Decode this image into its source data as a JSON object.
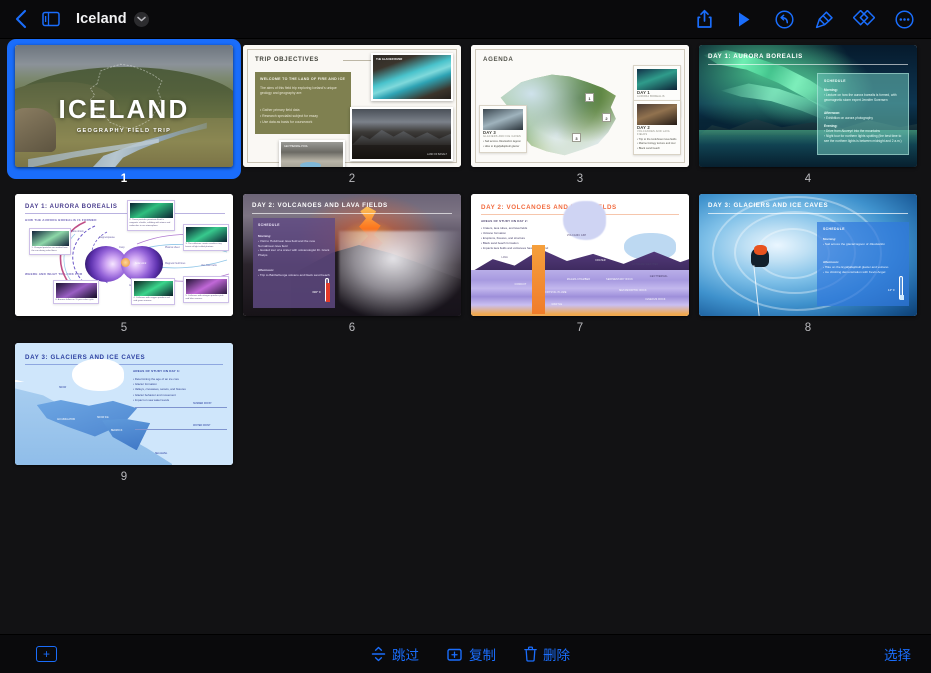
{
  "app": {
    "document_title": "Iceland",
    "accent_color": "#1a6dfb",
    "background_color": "#121214",
    "chrome_color": "#0a0a0c"
  },
  "topbar": {
    "back_icon": "chevron-left-icon",
    "sidebar_icon": "sidebar-toggle-icon",
    "title": "Iceland",
    "title_menu_icon": "chevron-down-icon",
    "actions": [
      {
        "name": "share-button",
        "icon": "share-icon"
      },
      {
        "name": "play-button",
        "icon": "play-icon"
      },
      {
        "name": "undo-button",
        "icon": "undo-icon"
      },
      {
        "name": "format-button",
        "icon": "paintbrush-icon"
      },
      {
        "name": "animate-button",
        "icon": "animate-diamonds-icon"
      },
      {
        "name": "more-button",
        "icon": "ellipsis-circle-icon"
      }
    ]
  },
  "bottombar": {
    "add_slide_label": "+",
    "add_slide_icon": "add-slide-icon",
    "skip_label": "跳过",
    "skip_icon": "skip-slide-icon",
    "duplicate_label": "复制",
    "duplicate_icon": "duplicate-icon",
    "delete_label": "删除",
    "delete_icon": "trash-icon",
    "select_label": "选择"
  },
  "grid": {
    "selected_slide": 1,
    "columns": 4,
    "slides": [
      {
        "number": "1",
        "title": "ICELAND",
        "subtitle": "GEOGRAPHY FIELD TRIP",
        "theme": "photo-hero-landscape",
        "selected": true
      },
      {
        "number": "2",
        "title": "TRIP OBJECTIVES",
        "theme": "cream-photo-collage",
        "box_heading": "WELCOME TO THE LAND OF FIRE AND ICE",
        "box_paragraph": "The aims of this field trip exploring Iceland's unique geology and geography are:",
        "bullets": [
          "Gather primary field data",
          "Research specialist subject for essay",
          "Use data as basis for coursework"
        ],
        "photo_captions": [
          "THE GLACIER RIVER",
          "LAND OF BASALT",
          "GEOTHERMAL POOL"
        ]
      },
      {
        "number": "3",
        "title": "AGENDA",
        "theme": "map-agenda",
        "map_markers": [
          "1",
          "2",
          "3"
        ],
        "cards": [
          {
            "day": "DAY 1",
            "subject": "AURORA BOREALIS",
            "points": [
              "Lecture on aurora borealis",
              "Aurora close-ups",
              "Viewing of northern lights"
            ]
          },
          {
            "day": "DAY 2",
            "subject": "VOLCANOES AND LAVA FIELDS",
            "points": [
              "Trip to the Holuhraun lava fields",
              "Marine biology lecture and tour",
              "Black sand beach"
            ]
          },
          {
            "day": "DAY 3",
            "subject": "GLACIERS AND ICE CAVES",
            "points": [
              "Sail across Jökulsárlón lagoon",
              "Hike to Eyjafjallajökull glacier"
            ]
          }
        ]
      },
      {
        "number": "4",
        "title": "DAY 1: AURORA BOREALIS",
        "theme": "aurora-photo",
        "panel_heading": "SCHEDULE",
        "segments": [
          {
            "label": "Morning:",
            "items": [
              "Lecture on how the aurora borealis is formed, with geomagnetic storm expert Jennifer Sorensen"
            ]
          },
          {
            "label": "Afternoon:",
            "items": [
              "Exhibition on aurora photography"
            ]
          },
          {
            "label": "Evening:",
            "items": [
              "Drive from Akureyri into the mountains",
              "Night tour for northern lights spotting (the best time to see the northern lights is between midnight and 2 a.m.)"
            ]
          }
        ]
      },
      {
        "number": "5",
        "title": "DAY 1: AURORA BOREALIS",
        "theme": "magnetosphere-diagram",
        "heading_1": "HOW THE AURORA BOREALIS IS FORMED",
        "heading_2": "WHERE AND WHAT TO LOOK FOR",
        "labels": [
          "Bow shock",
          "Magnetopause",
          "Cusp",
          "Plasma sheet",
          "Solar wind",
          "Magnetic field lines",
          "Van Allen belts",
          "Auroral oval"
        ],
        "callouts": [
          "1. Charged particles are emitted from the sun during solar flares.",
          "2. These particles penetrate Earth's magnetic shields, colliding with atoms and molecules in our atmosphere.",
          "3. The collisions create countless tiny bursts of light called photons.",
          "4. Collisions with oxygen produce red and green auroras.",
          "5. Collisions with nitrogen produce pink and blue auroras.",
          "6. Auroras follow an 11-year solar cycle."
        ]
      },
      {
        "number": "6",
        "title": "DAY 2: VOLCANOES AND LAVA FIELDS",
        "theme": "volcano-photo",
        "panel_heading": "SCHEDULE",
        "temperature": "390° F",
        "segments": [
          {
            "label": "Morning:",
            "items": [
              "Visit to Holuhraun lava field and the new Nornahraun lava field",
              "Guided tour of a crater with volcanologist Dr. Grant Phelps"
            ]
          },
          {
            "label": "Afternoon:",
            "items": [
              "Trip to Bárðarbunga volcano and black sand beach"
            ]
          }
        ]
      },
      {
        "number": "7",
        "title": "DAY 2: VOLCANOES AND LAVA FIELDS",
        "theme": "volcano-cross-section",
        "heading": "AREAS OF STUDY ON DAY 2:",
        "bullets": [
          "Craters, lava tubes, and lava fields",
          "Volcano formation",
          "Eruptions, fissures, and structure",
          "Black sand beach formation",
          "Impacts lava fields and volcanoes have on the land"
        ],
        "labels": [
          "VOLCANIC ASH",
          "LAVA",
          "CRATER",
          "EXTREME WEATHER",
          "GEOTHERMAL",
          "CONDUIT",
          "MAGMA CHAMBER",
          "SEDIMENTARY ROCK",
          "METAMORPHIC ROCK",
          "CRYSTAL PLUME",
          "MANTLE",
          "IGNEOUS ROCK",
          "SEDIMENTARY LAYER"
        ]
      },
      {
        "number": "8",
        "title": "DAY 3: GLACIERS AND ICE CAVES",
        "theme": "ice-cave-photo",
        "panel_heading": "SCHEDULE",
        "temperature": "14° F",
        "segments": [
          {
            "label": "Morning:",
            "items": [
              "Sail across the glacial lagoon of Jökulsárlón"
            ]
          },
          {
            "label": "Afternoon:",
            "items": [
              "Hike on the Eyjafjallajökull glacier and volcano",
              "Ice climbing demonstration with Kevin Angel"
            ]
          }
        ]
      },
      {
        "number": "9",
        "title": "DAY 3: GLACIERS AND ICE CAVES",
        "theme": "glacier-diagram",
        "heading": "AREAS OF STUDY ON DAY 3:",
        "bullets": [
          "Determining the age of an ice core",
          "Glacier formation",
          "Valleys, crevasses, seracs, and fissures",
          "Glacier behavior and movement",
          "Impact on sea water levels"
        ],
        "labels": [
          "SNOW",
          "ACCUMULATION",
          "SNOW ICE",
          "BEDROCK",
          "SUMMER FROST",
          "WINTER FROST",
          "SEA LEVEL"
        ]
      }
    ]
  }
}
